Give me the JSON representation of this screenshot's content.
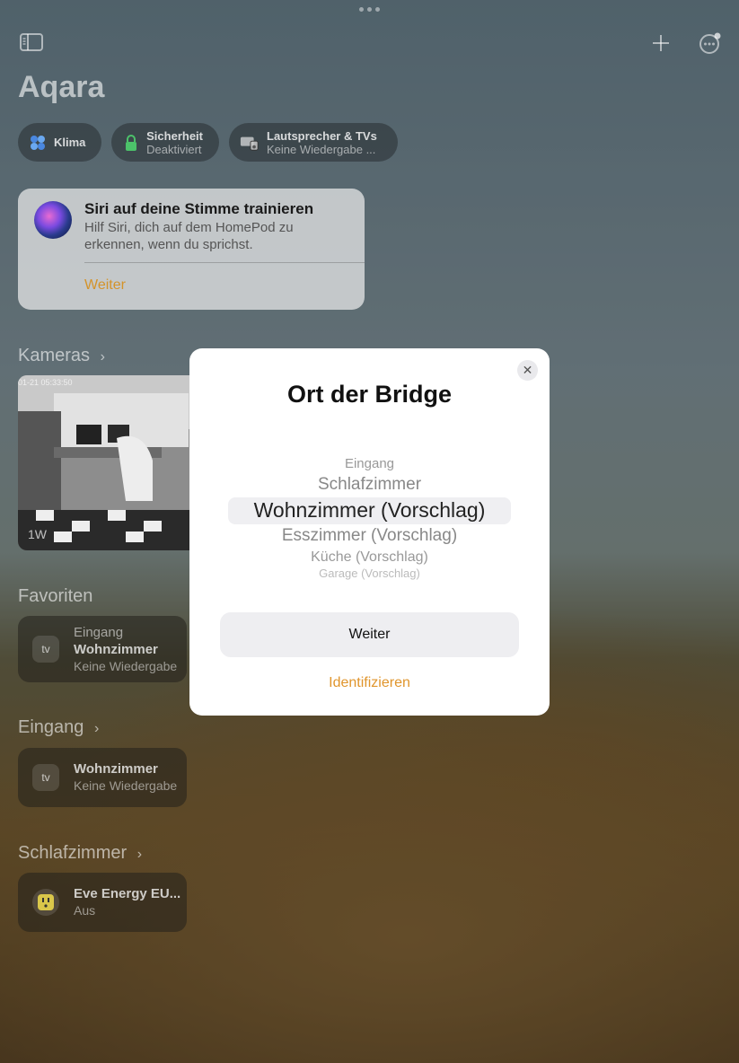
{
  "header": {
    "app_title": "Aqara",
    "sidebar_icon": "sidebar-toggle-icon",
    "add_icon": "plus-icon",
    "more_icon": "ellipsis-circle-icon"
  },
  "chips": [
    {
      "icon": "fan-icon",
      "title": "Klima",
      "subtitle": ""
    },
    {
      "icon": "lock-icon",
      "title": "Sicherheit",
      "subtitle": "Deaktiviert"
    },
    {
      "icon": "speaker-tv-icon",
      "title": "Lautsprecher & TVs",
      "subtitle": "Keine Wiedergabe ..."
    }
  ],
  "siri_card": {
    "title": "Siri auf deine Stimme trainieren",
    "text": "Hilf Siri, dich auf dem HomePod zu erkennen, wenn du sprichst.",
    "action": "Weiter"
  },
  "cameras": {
    "section": "Kameras",
    "timestamp": "01-21 05:33:50",
    "label": "1W"
  },
  "favorites": {
    "section": "Favoriten",
    "tile": {
      "icon_text": "tv",
      "line1": "Eingang",
      "line2": "Wohnzimmer",
      "line3": "Keine Wiedergabe"
    }
  },
  "eingang": {
    "section": "Eingang",
    "tile": {
      "icon_text": "tv",
      "line2": "Wohnzimmer",
      "line3": "Keine Wiedergabe"
    }
  },
  "schlafzimmer": {
    "section": "Schlafzimmer",
    "tile": {
      "line2": "Eve Energy EU...",
      "line3": "Aus"
    }
  },
  "modal": {
    "title": "Ort der Bridge",
    "options": [
      "Eingang",
      "Schlafzimmer",
      "Wohnzimmer (Vorschlag)",
      "Esszimmer (Vorschlag)",
      "Küche (Vorschlag)",
      "Garage (Vorschlag)"
    ],
    "selected_index": 2,
    "primary_button": "Weiter",
    "secondary_button": "Identifizieren",
    "accent_color": "#e0952c"
  }
}
